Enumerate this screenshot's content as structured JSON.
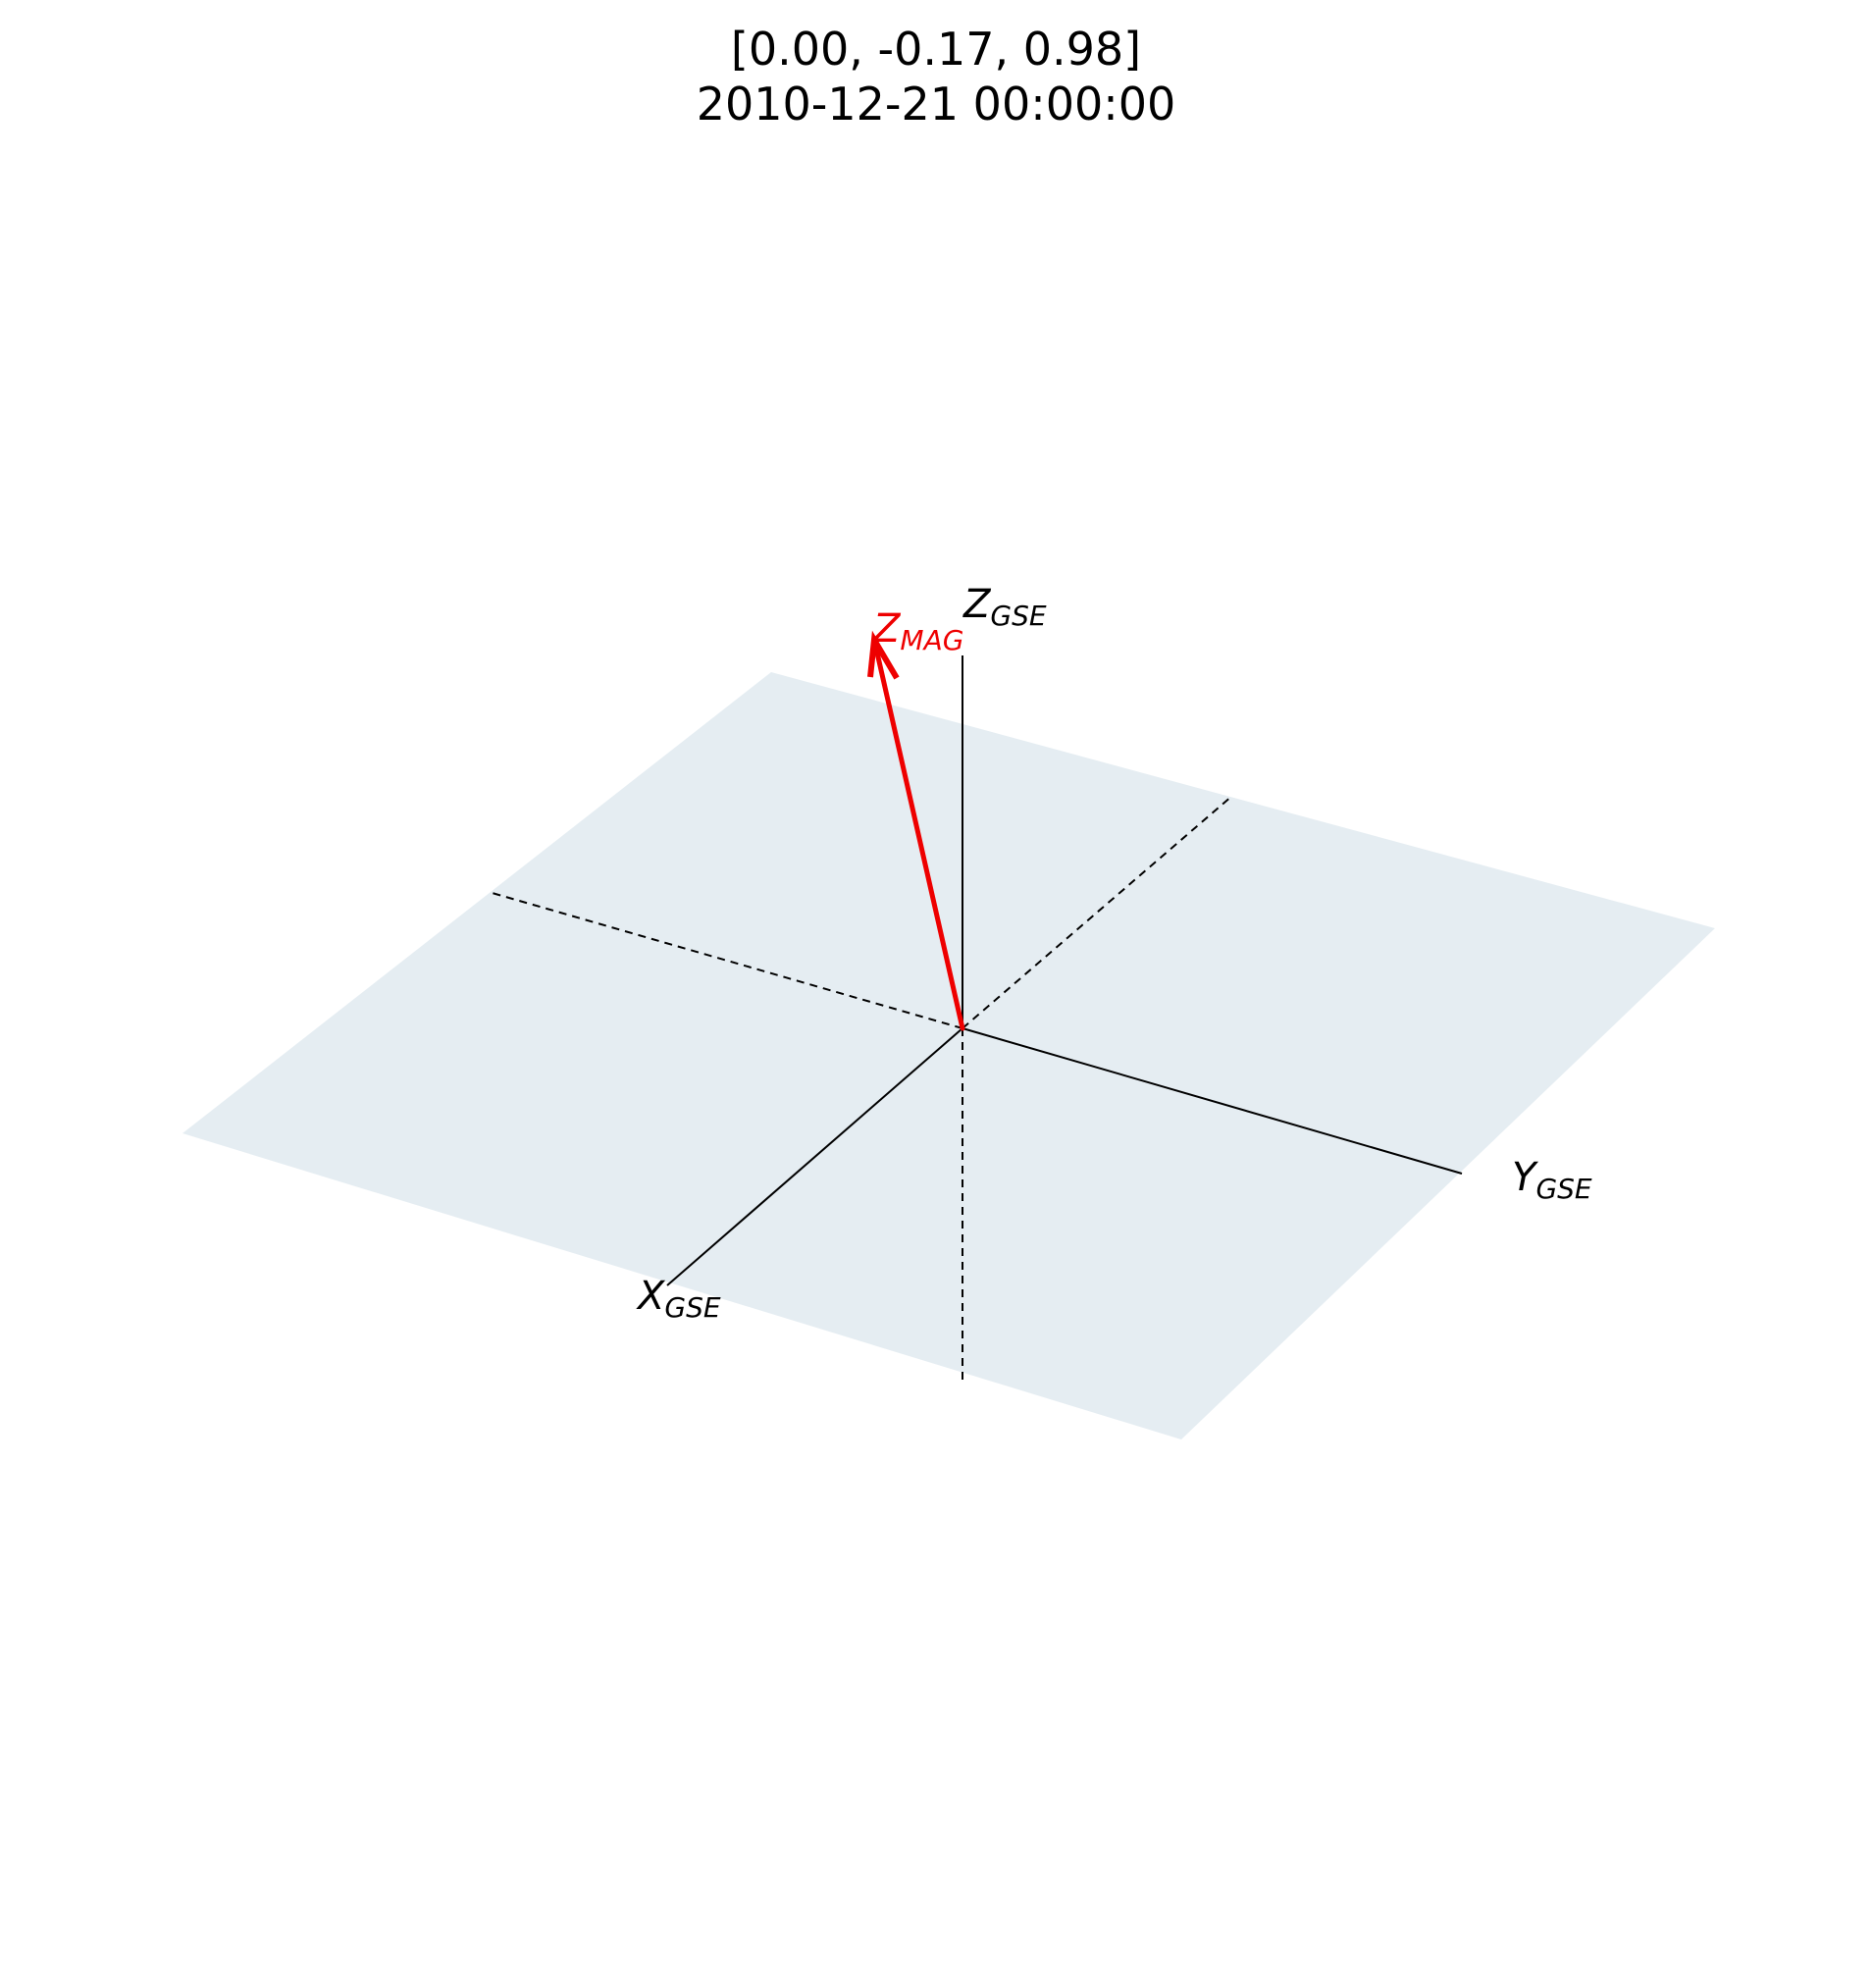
{
  "title": {
    "line1": "[0.00, -0.17, 0.98]",
    "line2": "2010-12-21 00:00:00"
  },
  "axes": {
    "x": {
      "main": "X",
      "sub": "GSE",
      "color": "#000000"
    },
    "y": {
      "main": "Y",
      "sub": "GSE",
      "color": "#000000"
    },
    "z": {
      "main": "Z",
      "sub": "GSE",
      "color": "#000000"
    }
  },
  "vector": {
    "main": "Z",
    "sub": "MAG",
    "components": [
      0.0,
      -0.17,
      0.98
    ],
    "color": "#ee0000"
  },
  "plane": {
    "fill_color": "#e5edf2"
  }
}
